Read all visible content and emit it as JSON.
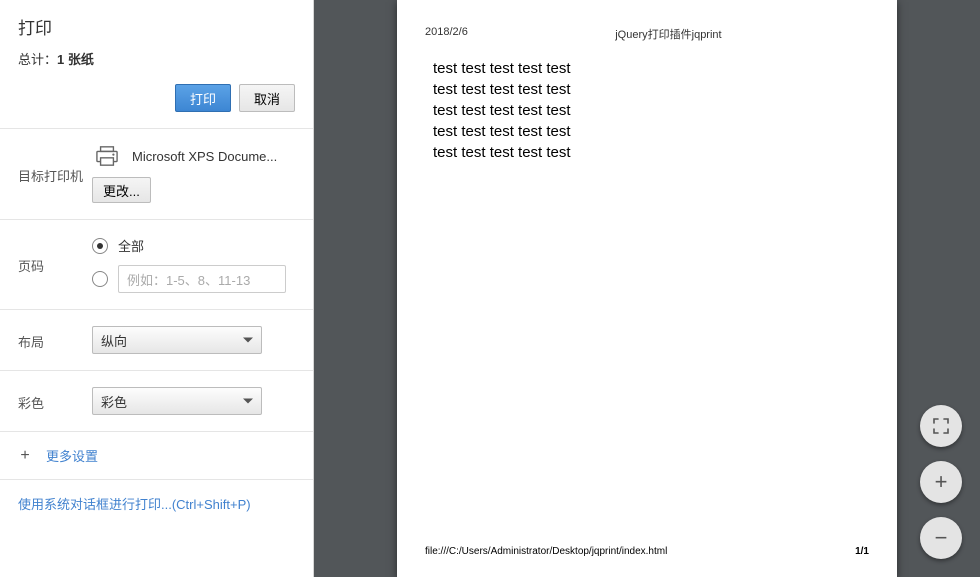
{
  "header": {
    "title": "打印",
    "total_prefix": "总计：",
    "total_value": "1 张纸"
  },
  "buttons": {
    "print": "打印",
    "cancel": "取消"
  },
  "printer": {
    "label": "目标打印机",
    "name": "Microsoft XPS Docume...",
    "change": "更改..."
  },
  "pages": {
    "label": "页码",
    "all": "全部",
    "range_placeholder": "例如：1-5、8、11-13"
  },
  "layout": {
    "label": "布局",
    "value": "纵向"
  },
  "color": {
    "label": "彩色",
    "value": "彩色"
  },
  "more": {
    "label": "更多设置"
  },
  "syslink": {
    "text": "使用系统对话框进行打印...(Ctrl+Shift+P)"
  },
  "preview": {
    "date": "2018/2/6",
    "title": "jQuery打印插件jqprint",
    "lines": [
      "test test test test test",
      "test test test test test",
      "test test test test test",
      "test test test test test",
      "test test test test test"
    ],
    "footer_url": "file:///C:/Users/Administrator/Desktop/jqprint/index.html",
    "page_number": "1/1"
  }
}
